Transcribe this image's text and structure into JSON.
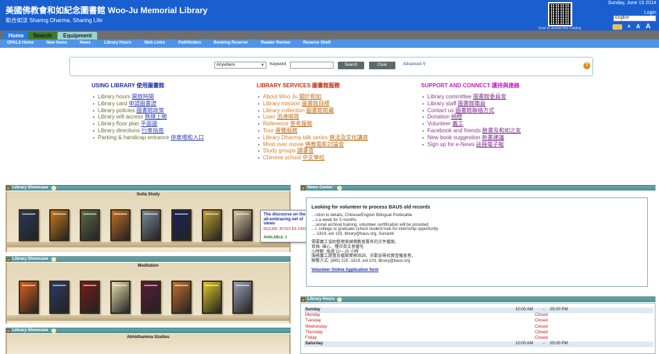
{
  "header": {
    "brand_zh": "美國佛教會和如紀念圖書館",
    "brand_en": "Woo-Ju Memorial Library",
    "tagline": "和合如法 Sharing Dharma, Sharing Life",
    "qr_caption": "Scan to access this Catalog",
    "date": "Sunday, June 15 2014",
    "login": "Login",
    "language": "English",
    "font_sizes": [
      "A",
      "A",
      "A"
    ]
  },
  "tabs": [
    "Home",
    "Search",
    "Equipment"
  ],
  "nav": [
    "OPALS Home",
    "New Items",
    "News",
    "Library Hours",
    "Web Links",
    "Pathfinders",
    "Booking Reserve",
    "Reader Review",
    "Reserve Shelf"
  ],
  "search": {
    "scope": "Anywhere",
    "keyword_label": "Keyword",
    "keyword_value": "",
    "search_btn": "Search",
    "clear_btn": "Clear",
    "advanced": "Advanced",
    "help": "?"
  },
  "using": {
    "title": "USING LIBRARY 使用圖書館",
    "items": [
      {
        "en": "Library hours",
        "zh": "開放時間"
      },
      {
        "en": "Library card",
        "zh": "申請圖書證"
      },
      {
        "en": "Library policies",
        "zh": "圖書館政策"
      },
      {
        "en": "Library wifi access",
        "zh": "無線上網"
      },
      {
        "en": "Library floor plan",
        "zh": "平面圖"
      },
      {
        "en": "Library directions",
        "zh": "行車指南"
      },
      {
        "en": "Parking & handicap entrance",
        "zh": "停車場和入口"
      }
    ]
  },
  "services": {
    "title": "LIBRARY SERVICES 圖書館服務",
    "items": [
      {
        "en": "About Woo Ju",
        "zh": "關於和如"
      },
      {
        "en": "Library mission",
        "zh": "圖書館目標"
      },
      {
        "en": "Library collection",
        "zh": "圖書館館藏"
      },
      {
        "en": "Loan",
        "zh": "流通借閱"
      },
      {
        "en": "Reference",
        "zh": "參考服務"
      },
      {
        "en": "Tour",
        "zh": "導覽服務"
      },
      {
        "en": "Library Dharma talk series",
        "zh": "佛法及文化講座"
      },
      {
        "en": "Mind over movie",
        "zh": "佛教電影討論會"
      },
      {
        "en": "Study groups",
        "zh": "讀書會"
      },
      {
        "en": "Chinese school",
        "zh": "中文學校"
      }
    ]
  },
  "support": {
    "title": "SUPPORT AND CONNECT 護持與連絡",
    "items": [
      {
        "en": "Library committee",
        "zh": "圖書館委員會"
      },
      {
        "en": "Library staff",
        "zh": "圖書館職員"
      },
      {
        "en": "Contact us",
        "zh": "圖書館聯絡方式"
      },
      {
        "en": "Donation",
        "zh": "捐贈"
      },
      {
        "en": "Volunteer",
        "zh": "義工"
      },
      {
        "en": "Facebook and friends",
        "zh": "臉書及和如之友"
      },
      {
        "en": "New book suggestion",
        "zh": "新書建議"
      },
      {
        "en": "Sign up for e-News",
        "zh": "註冊電子報"
      }
    ]
  },
  "showcases": [
    {
      "bar": "Library Showcase",
      "title": "Sutta Study"
    },
    {
      "bar": "Library Showcase",
      "title": "Meditation"
    },
    {
      "bar": "Library Showcase",
      "title": "Abhidhamma Studies"
    }
  ],
  "book_colors": {
    "sutta": [
      "#2a3a5a",
      "#c9781a",
      "#5a6a4a",
      "#c07020",
      "#7a8a9a",
      "#1a2460",
      "#c0a030",
      "#d8c8a0"
    ],
    "meditation": [
      "#d86020",
      "#2a3a6a",
      "#7a1a1a",
      "#e8e0b0",
      "#5a1a3a",
      "#c07030",
      "#e0c828",
      "#9aa0b8"
    ]
  },
  "tooltip": {
    "title": "The discourse on the all-embracing net of views",
    "call": "BQ1300 .B7322 E5 1992",
    "available": "AVAILABLE: 3"
  },
  "news": {
    "bar": "News Center",
    "heading": "Looking for volunteer to process BAUS old records",
    "lines": [
      "…ntion to details, Chinese/English Bilingual Preferable",
      "…s a week for 3 months",
      "…sional archival training, volunteer certification will be provided",
      "…l, college or graduate school student look for internship opportunity",
      "…-1819, ext 103, library@baus.org, Sunandi",
      "",
      "需要義工協助整理美國佛教會舊有的文件檔案。",
      "資格: 細心、懂中英文者優先",
      "小時數: 每週 10－20 小時",
      "服務義工證書及檔案實務培訓，亦歡迎尋找實習機會者。",
      "聯繫方式: (845) 225 -1819, ext 103, library@baus.org"
    ],
    "link": "Volunteer Online Application form"
  },
  "hours": {
    "bar": "Library Hours",
    "rows": [
      {
        "day": "Sunday",
        "open": "10:00 AM",
        "close": "05:00 PM",
        "closed": false
      },
      {
        "day": "Monday",
        "closed_label": "Closed",
        "closed": true
      },
      {
        "day": "Tuesday",
        "closed_label": "Closed",
        "closed": true
      },
      {
        "day": "Wednesday",
        "closed_label": "Closed",
        "closed": true
      },
      {
        "day": "Thursday",
        "closed_label": "Closed",
        "closed": true
      },
      {
        "day": "Friday",
        "closed_label": "Closed",
        "closed": true
      },
      {
        "day": "Saturday",
        "open": "10:00 AM",
        "close": "05:00 PM",
        "closed": false
      }
    ]
  }
}
